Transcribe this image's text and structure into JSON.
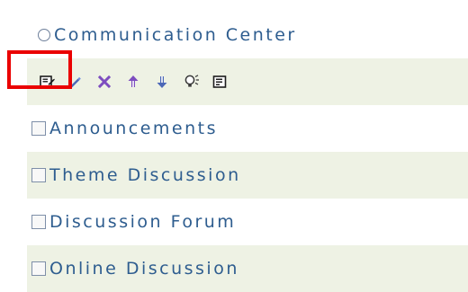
{
  "header": {
    "title": "Communication Center"
  },
  "toolbar": {
    "items": [
      "edit-icon",
      "pencil-icon",
      "delete-icon",
      "move-up-icon",
      "move-down-icon",
      "lightbulb-icon",
      "view-icon"
    ]
  },
  "list": {
    "items": [
      {
        "label": "Announcements"
      },
      {
        "label": "Theme Discussion"
      },
      {
        "label": "Discussion Forum"
      },
      {
        "label": "Online Discussion"
      }
    ]
  },
  "colors": {
    "text": "#2e5d8f",
    "row_alt": "#eef2e4",
    "highlight": "#ea0000",
    "accent_purple": "#7d4dbf"
  }
}
